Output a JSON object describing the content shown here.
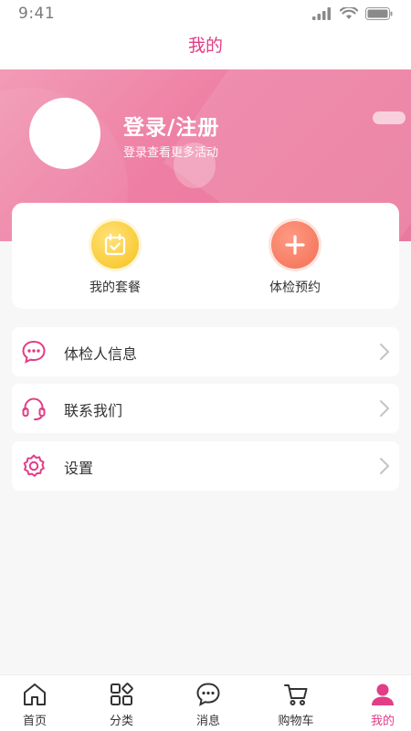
{
  "status_bar": {
    "time": "9:41"
  },
  "header": {
    "title": "我的"
  },
  "profile": {
    "login_title": "登录/注册",
    "login_subtitle": "登录查看更多活动"
  },
  "quick_actions": [
    {
      "label": "我的套餐",
      "icon": "calendar-check-icon",
      "color": "#f8c51f"
    },
    {
      "label": "体检预约",
      "icon": "plus-icon",
      "color": "#f26f55"
    }
  ],
  "menu": [
    {
      "label": "体检人信息",
      "icon": "chat-bubble-icon"
    },
    {
      "label": "联系我们",
      "icon": "headset-icon"
    },
    {
      "label": "设置",
      "icon": "gear-icon"
    }
  ],
  "tabs": [
    {
      "label": "首页",
      "icon": "home-icon"
    },
    {
      "label": "分类",
      "icon": "category-icon"
    },
    {
      "label": "消息",
      "icon": "message-icon"
    },
    {
      "label": "购物车",
      "icon": "cart-icon"
    },
    {
      "label": "我的",
      "icon": "user-icon",
      "active": true
    }
  ],
  "colors": {
    "accent": "#e23d86",
    "hero": "#ee7ea3",
    "background": "#f7f7f8"
  }
}
